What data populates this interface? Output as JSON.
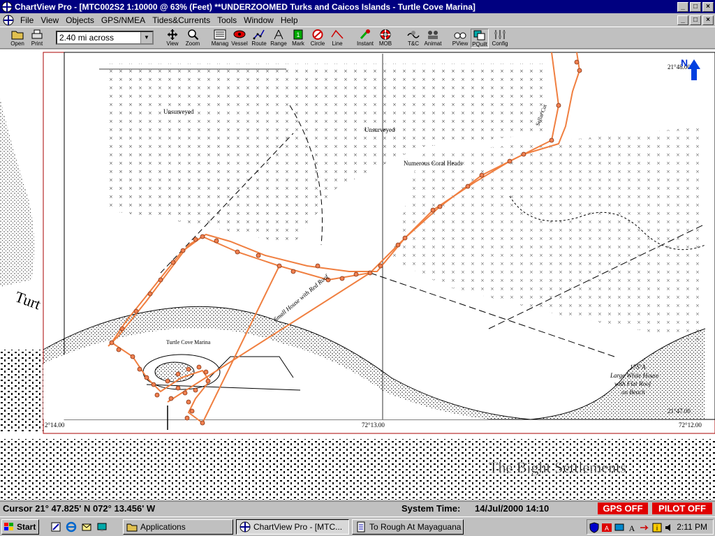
{
  "window": {
    "title": "ChartView Pro - [MTC002S2 1:10000 @ 63% (Feet) **UNDERZOOMED Turks and Caicos Islands - Turtle Cove Marina]"
  },
  "menu": [
    "File",
    "View",
    "Objects",
    "GPS/NMEA",
    "Tides&Currents",
    "Tools",
    "Window",
    "Help"
  ],
  "toolbar": {
    "open": "Open",
    "print": "Print",
    "scale_value": "2.40 mi across",
    "view": "View",
    "zoom": "Zoom",
    "manage": "Manag",
    "vessel": "Vessel",
    "route": "Route",
    "range": "Range",
    "mark": "Mark",
    "circle": "Circle",
    "line": "Line",
    "instant": "Instant",
    "mob": "MOB",
    "tc": "T&C",
    "animat": "Animat",
    "pview": "PView",
    "pquilt": "PQuilt",
    "config": "Config"
  },
  "chart": {
    "labels": {
      "unsurveyed_1": "Unsurveyed",
      "unsurveyed_2": "Unsurveyed",
      "coral": "Numerous Coral Heads",
      "marina": "Turtle Cove Marina",
      "small_house": "Small House with Red Roof",
      "large_house_1": "175°A",
      "large_house_2": "Large White House",
      "large_house_3": "with Flat Roof",
      "large_house_4": "on Beach",
      "sellar_cut": "Sellar Cut",
      "bight": "The Bight Settlements",
      "turtle": "Turt",
      "lat_top": "21°48.00",
      "lat_bottom": "21°47.00",
      "lon_left": "2°14.00",
      "lon_mid": "72°13.00",
      "lon_right": "72°12.00",
      "north": "N"
    },
    "track_color": "#f07f40"
  },
  "status": {
    "cursor": "Cursor 21° 47.825' N  072° 13.456' W",
    "time_label": "System Time:",
    "time_value": "14/Jul/2000  14:10",
    "gps": "GPS OFF",
    "pilot": "PILOT OFF"
  },
  "taskbar": {
    "start": "Start",
    "tasks": [
      "Applications",
      "ChartView Pro - [MTC...",
      "To Rough At Mayaguana -..."
    ],
    "clock": "2:11 PM"
  }
}
